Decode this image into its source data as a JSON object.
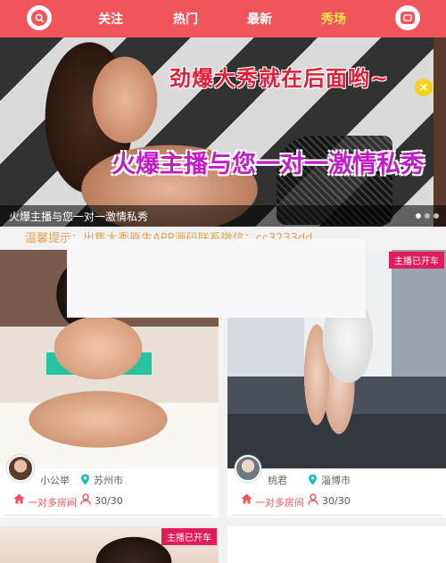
{
  "nav": {
    "search_icon": "search-icon",
    "message_icon": "message-icon",
    "tabs": [
      {
        "label": "关注"
      },
      {
        "label": "热门"
      },
      {
        "label": "最新"
      },
      {
        "label": "秀场",
        "active": true
      }
    ],
    "accent_color": "#f0555b",
    "active_tab_color": "#ffe14d"
  },
  "banner": {
    "headline": "劲爆大秀就在后面哟~",
    "subline": "火爆主播与您一对一激情私秀",
    "caption": "火爆主播与您一对一激情私秀",
    "slide_count": 3,
    "active_slide": 1
  },
  "notice": {
    "text": "温馨提示：出售大秀原生APP源码联系微信：cc3233dd"
  },
  "cards": [
    {
      "badge": "",
      "anchor_name": "小公举",
      "city": "苏州市",
      "room_type": "一对多房间",
      "occupancy": "30/30"
    },
    {
      "badge": "主播已开车",
      "anchor_name": "桃君",
      "city": "淄博市",
      "room_type": "一对多房间",
      "occupancy": "30/30"
    },
    {
      "badge": "主播已开车"
    }
  ]
}
